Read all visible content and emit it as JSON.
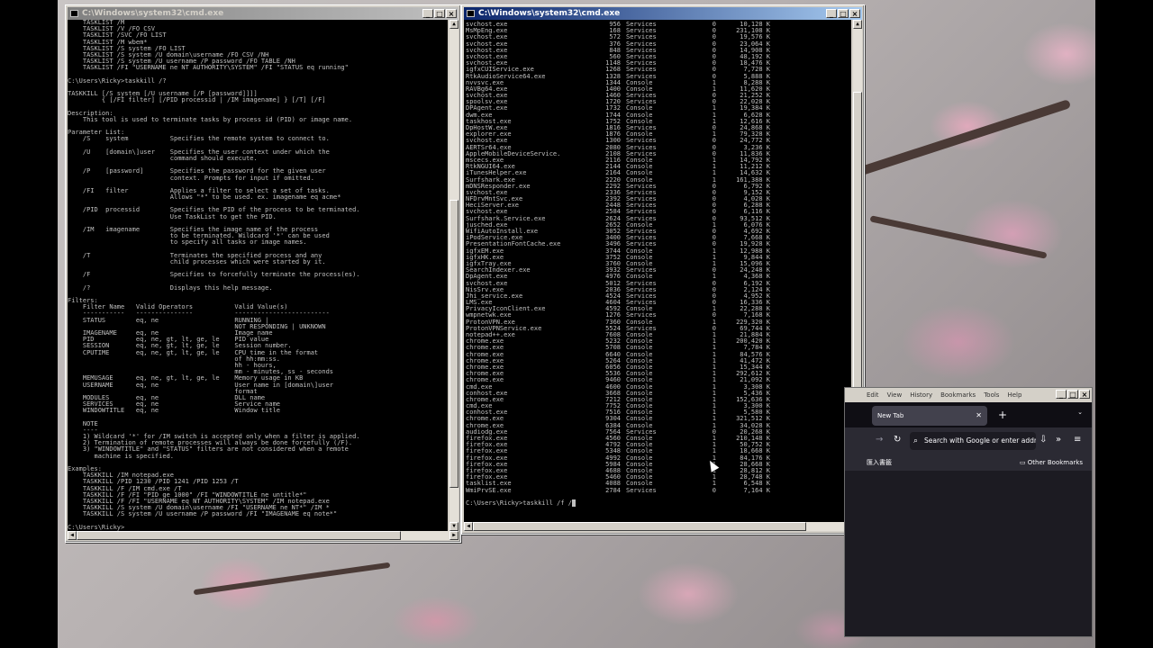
{
  "left_window": {
    "title": "C:\\Windows\\system32\\cmd.exe",
    "lines": [
      "    TASKLIST /M",
      "    TASKLIST /V /FO CSV",
      "    TASKLIST /SVC /FO LIST",
      "    TASKLIST /M wbem*",
      "    TASKLIST /S system /FO LIST",
      "    TASKLIST /S system /U domain\\username /FO CSV /NH",
      "    TASKLIST /S system /U username /P password /FO TABLE /NH",
      "    TASKLIST /FI \"USERNAME ne NT AUTHORITY\\SYSTEM\" /FI \"STATUS eq running\"",
      "",
      "C:\\Users\\Ricky>taskkill /?",
      "",
      "TASKKILL [/S system [/U username [/P [password]]]]",
      "         { [/FI filter] [/PID processid | /IM imagename] } [/T] [/F]",
      "",
      "Description:",
      "    This tool is used to terminate tasks by process id (PID) or image name.",
      "",
      "Parameter List:",
      "    /S    system           Specifies the remote system to connect to.",
      "",
      "    /U    [domain\\]user    Specifies the user context under which the",
      "                           command should execute.",
      "",
      "    /P    [password]       Specifies the password for the given user",
      "                           context. Prompts for input if omitted.",
      "",
      "    /FI   filter           Applies a filter to select a set of tasks.",
      "                           Allows \"*\" to be used. ex. imagename eq acme*",
      "",
      "    /PID  processid        Specifies the PID of the process to be terminated.",
      "                           Use TaskList to get the PID.",
      "",
      "    /IM   imagename        Specifies the image name of the process",
      "                           to be terminated. Wildcard '*' can be used",
      "                           to specify all tasks or image names.",
      "",
      "    /T                     Terminates the specified process and any",
      "                           child processes which were started by it.",
      "",
      "    /F                     Specifies to forcefully terminate the process(es).",
      "",
      "    /?                     Displays this help message.",
      "",
      "Filters:",
      "    Filter Name   Valid Operators           Valid Value(s)",
      "    -----------   ---------------           -------------------------",
      "    STATUS        eq, ne                    RUNNING |",
      "                                            NOT RESPONDING | UNKNOWN",
      "    IMAGENAME     eq, ne                    Image name",
      "    PID           eq, ne, gt, lt, ge, le    PID value",
      "    SESSION       eq, ne, gt, lt, ge, le    Session number.",
      "    CPUTIME       eq, ne, gt, lt, ge, le    CPU time in the format",
      "                                            of hh:mm:ss.",
      "                                            hh - hours,",
      "                                            mm - minutes, ss - seconds",
      "    MEMUSAGE      eq, ne, gt, lt, ge, le    Memory usage in KB",
      "    USERNAME      eq, ne                    User name in [domain\\]user",
      "                                            format",
      "    MODULES       eq, ne                    DLL name",
      "    SERVICES      eq, ne                    Service name",
      "    WINDOWTITLE   eq, ne                    Window title",
      "",
      "    NOTE",
      "    ----",
      "    1) Wildcard '*' for /IM switch is accepted only when a filter is applied.",
      "    2) Termination of remote processes will always be done forcefully (/F).",
      "    3) \"WINDOWTITLE\" and \"STATUS\" filters are not considered when a remote",
      "       machine is specified.",
      "",
      "Examples:",
      "    TASKKILL /IM notepad.exe",
      "    TASKKILL /PID 1230 /PID 1241 /PID 1253 /T",
      "    TASKKILL /F /IM cmd.exe /T",
      "    TASKKILL /F /FI \"PID ge 1000\" /FI \"WINDOWTITLE ne untitle*\"",
      "    TASKKILL /F /FI \"USERNAME eq NT AUTHORITY\\SYSTEM\" /IM notepad.exe",
      "    TASKKILL /S system /U domain\\username /FI \"USERNAME ne NT*\" /IM *",
      "    TASKKILL /S system /U username /P password /FI \"IMAGENAME eq note*\"",
      "",
      "C:\\Users\\Ricky>"
    ]
  },
  "right_window": {
    "title": "C:\\Windows\\system32\\cmd.exe",
    "processes": [
      [
        "svchost.exe",
        "956",
        "Services",
        "0",
        "10,128 K"
      ],
      [
        "MsMpEng.exe",
        "168",
        "Services",
        "0",
        "231,108 K"
      ],
      [
        "svchost.exe",
        "572",
        "Services",
        "0",
        "19,576 K"
      ],
      [
        "svchost.exe",
        "376",
        "Services",
        "0",
        "23,064 K"
      ],
      [
        "svchost.exe",
        "848",
        "Services",
        "0",
        "14,908 K"
      ],
      [
        "svchost.exe",
        "560",
        "Services",
        "0",
        "48,192 K"
      ],
      [
        "svchost.exe",
        "1148",
        "Services",
        "0",
        "18,476 K"
      ],
      [
        "igfxCUIService.exe",
        "1268",
        "Services",
        "0",
        "7,728 K"
      ],
      [
        "RtkAudioService64.exe",
        "1328",
        "Services",
        "0",
        "5,888 K"
      ],
      [
        "nvvsvc.exe",
        "1344",
        "Console",
        "1",
        "8,288 K"
      ],
      [
        "RAVBg64.exe",
        "1400",
        "Console",
        "1",
        "11,620 K"
      ],
      [
        "svchost.exe",
        "1460",
        "Services",
        "0",
        "21,252 K"
      ],
      [
        "spoolsv.exe",
        "1720",
        "Services",
        "0",
        "22,028 K"
      ],
      [
        "DPAgent.exe",
        "1732",
        "Console",
        "1",
        "19,384 K"
      ],
      [
        "dwm.exe",
        "1744",
        "Console",
        "1",
        "6,628 K"
      ],
      [
        "taskhost.exe",
        "1752",
        "Console",
        "1",
        "12,616 K"
      ],
      [
        "DpHostW.exe",
        "1816",
        "Services",
        "0",
        "24,868 K"
      ],
      [
        "explorer.exe",
        "1876",
        "Console",
        "1",
        "79,328 K"
      ],
      [
        "svchost.exe",
        "1300",
        "Services",
        "0",
        "24,772 K"
      ],
      [
        "AERTSr64.exe",
        "2080",
        "Services",
        "0",
        "3,236 K"
      ],
      [
        "AppleMobileDeviceService.",
        "2108",
        "Services",
        "0",
        "11,836 K"
      ],
      [
        "mscecs.exe",
        "2116",
        "Console",
        "1",
        "14,792 K"
      ],
      [
        "RtkNGUI64.exe",
        "2144",
        "Console",
        "1",
        "11,212 K"
      ],
      [
        "iTunesHelper.exe",
        "2164",
        "Console",
        "1",
        "14,632 K"
      ],
      [
        "Surfshark.exe",
        "2220",
        "Console",
        "1",
        "161,388 K"
      ],
      [
        "mDNSResponder.exe",
        "2292",
        "Services",
        "0",
        "6,792 K"
      ],
      [
        "svchost.exe",
        "2336",
        "Services",
        "0",
        "9,152 K"
      ],
      [
        "NFDrvMntSvc.exe",
        "2392",
        "Services",
        "0",
        "4,028 K"
      ],
      [
        "HeciServer.exe",
        "2448",
        "Services",
        "0",
        "6,288 K"
      ],
      [
        "svchost.exe",
        "2584",
        "Services",
        "0",
        "6,116 K"
      ],
      [
        "Surfshark.Service.exe",
        "2624",
        "Services",
        "0",
        "93,512 K"
      ],
      [
        "jusched.exe",
        "2652",
        "Console",
        "1",
        "6,076 K"
      ],
      [
        "WifiAutoInstall.exe",
        "3052",
        "Services",
        "0",
        "4,692 K"
      ],
      [
        "iPodService.exe",
        "3400",
        "Services",
        "0",
        "7,668 K"
      ],
      [
        "PresentationFontCache.exe",
        "3496",
        "Services",
        "0",
        "19,928 K"
      ],
      [
        "igfxEM.exe",
        "3744",
        "Console",
        "1",
        "12,988 K"
      ],
      [
        "igfxHK.exe",
        "3752",
        "Console",
        "1",
        "9,844 K"
      ],
      [
        "igfxTray.exe",
        "3760",
        "Console",
        "1",
        "15,096 K"
      ],
      [
        "SearchIndexer.exe",
        "3932",
        "Services",
        "0",
        "24,248 K"
      ],
      [
        "DpAgent.exe",
        "4976",
        "Console",
        "1",
        "4,368 K"
      ],
      [
        "svchost.exe",
        "5012",
        "Services",
        "0",
        "6,192 K"
      ],
      [
        "NisSrv.exe",
        "2036",
        "Services",
        "0",
        "2,124 K"
      ],
      [
        "Jhi_service.exe",
        "4524",
        "Services",
        "0",
        "4,952 K"
      ],
      [
        "LMS.exe",
        "4604",
        "Services",
        "0",
        "16,336 K"
      ],
      [
        "PrivacyIconClient.exe",
        "4592",
        "Console",
        "1",
        "22,288 K"
      ],
      [
        "wmpnetwk.exe",
        "1276",
        "Services",
        "0",
        "7,168 K"
      ],
      [
        "ProtonVPN.exe",
        "7360",
        "Console",
        "1",
        "229,320 K"
      ],
      [
        "ProtonVPNService.exe",
        "5524",
        "Services",
        "0",
        "69,744 K"
      ],
      [
        "notepad++.exe",
        "7608",
        "Console",
        "1",
        "21,884 K"
      ],
      [
        "chrome.exe",
        "5232",
        "Console",
        "1",
        "200,420 K"
      ],
      [
        "chrome.exe",
        "5708",
        "Console",
        "1",
        "7,784 K"
      ],
      [
        "chrome.exe",
        "6640",
        "Console",
        "1",
        "84,576 K"
      ],
      [
        "chrome.exe",
        "5264",
        "Console",
        "1",
        "41,472 K"
      ],
      [
        "chrome.exe",
        "6056",
        "Console",
        "1",
        "15,344 K"
      ],
      [
        "chrome.exe",
        "5536",
        "Console",
        "1",
        "292,612 K"
      ],
      [
        "chrome.exe",
        "9460",
        "Console",
        "1",
        "21,092 K"
      ],
      [
        "cmd.exe",
        "4600",
        "Console",
        "1",
        "3,308 K"
      ],
      [
        "conhost.exe",
        "3668",
        "Console",
        "1",
        "5,436 K"
      ],
      [
        "chrome.exe",
        "7212",
        "Console",
        "1",
        "152,636 K"
      ],
      [
        "cmd.exe",
        "7752",
        "Console",
        "1",
        "3,300 K"
      ],
      [
        "conhost.exe",
        "7516",
        "Console",
        "1",
        "5,580 K"
      ],
      [
        "chrome.exe",
        "9304",
        "Console",
        "1",
        "321,512 K"
      ],
      [
        "chrome.exe",
        "6384",
        "Console",
        "1",
        "34,028 K"
      ],
      [
        "audiodg.exe",
        "7564",
        "Services",
        "0",
        "20,268 K"
      ],
      [
        "firefox.exe",
        "4560",
        "Console",
        "1",
        "210,148 K"
      ],
      [
        "firefox.exe",
        "4792",
        "Console",
        "1",
        "50,752 K"
      ],
      [
        "firefox.exe",
        "5348",
        "Console",
        "1",
        "18,668 K"
      ],
      [
        "firefox.exe",
        "4992",
        "Console",
        "1",
        "84,176 K"
      ],
      [
        "firefox.exe",
        "5984",
        "Console",
        "1",
        "28,668 K"
      ],
      [
        "firefox.exe",
        "4688",
        "Console",
        "1",
        "28,812 K"
      ],
      [
        "firefox.exe",
        "5460",
        "Console",
        "1",
        "28,748 K"
      ],
      [
        "tasklist.exe",
        "4088",
        "Console",
        "1",
        "6,548 K"
      ],
      [
        "WmiPrvSE.exe",
        "2784",
        "Services",
        "0",
        "7,164 K"
      ]
    ],
    "prompt": "C:\\Users\\Ricky>taskkill /f /"
  },
  "firefox": {
    "menu": [
      "Edit",
      "View",
      "History",
      "Bookmarks",
      "Tools",
      "Help"
    ],
    "tab_title": "New Tab",
    "url_placeholder": "Search with Google or enter address",
    "bookmark_left": "匯入書籤",
    "bookmark_right": "Other Bookmarks"
  }
}
